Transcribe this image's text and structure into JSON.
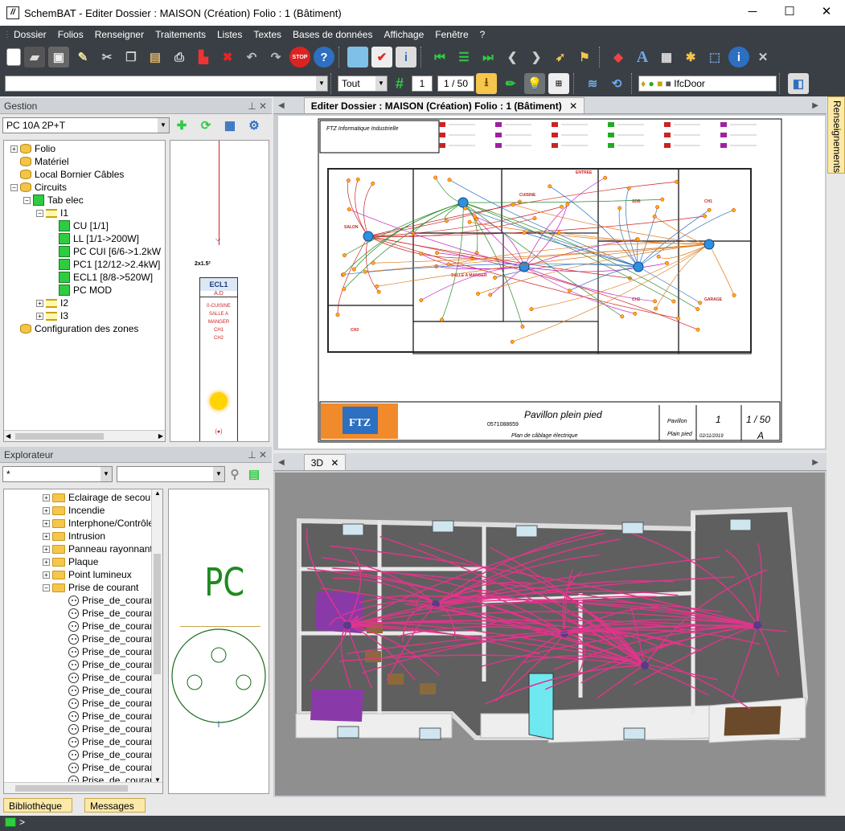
{
  "window": {
    "title": "SchemBAT - Editer  Dossier : MAISON  (Création)  Folio : 1  (Bâtiment)",
    "minimize": "─",
    "maximize": "☐",
    "close": "✕"
  },
  "menu": [
    "Dossier",
    "Folios",
    "Renseigner",
    "Traitements",
    "Listes",
    "Textes",
    "Bases de données",
    "Affichage",
    "Fenêtre",
    "?"
  ],
  "toolbar2": {
    "filter_value": "Tout",
    "page_input": "1",
    "page_count": "1 / 50",
    "layer_value": "IfcDoor"
  },
  "gestion": {
    "title": "Gestion",
    "pin": "⊥ ✕",
    "selected": "PC 10A 2P+T",
    "tree": [
      {
        "label": "Folio",
        "icon": "db",
        "indent": 0,
        "exp": "+"
      },
      {
        "label": "Matériel",
        "icon": "db",
        "indent": 0,
        "exp": ""
      },
      {
        "label": "Local Bornier Câbles",
        "icon": "db",
        "indent": 0,
        "exp": ""
      },
      {
        "label": "Circuits",
        "icon": "db",
        "indent": 0,
        "exp": "−"
      },
      {
        "label": "Tab elec",
        "icon": "green",
        "indent": 1,
        "exp": "−"
      },
      {
        "label": "I1",
        "icon": "rung",
        "indent": 2,
        "exp": "−"
      },
      {
        "label": "CU [1/1]",
        "icon": "green",
        "indent": 3,
        "exp": ""
      },
      {
        "label": "LL [1/1->200W]",
        "icon": "green",
        "indent": 3,
        "exp": ""
      },
      {
        "label": "PC CUI [6/6->1.2kW",
        "icon": "green",
        "indent": 3,
        "exp": ""
      },
      {
        "label": "PC1 [12/12->2.4kW]",
        "icon": "green",
        "indent": 3,
        "exp": ""
      },
      {
        "label": "ECL1 [8/8->520W]",
        "icon": "green",
        "indent": 3,
        "exp": ""
      },
      {
        "label": "PC MOD",
        "icon": "green",
        "indent": 3,
        "exp": ""
      },
      {
        "label": "I2",
        "icon": "rung",
        "indent": 2,
        "exp": "+"
      },
      {
        "label": "I3",
        "icon": "rung",
        "indent": 2,
        "exp": "+"
      },
      {
        "label": "Configuration des zones",
        "icon": "db",
        "indent": 0,
        "exp": ""
      }
    ],
    "circuit_preview": {
      "label": "ECL1",
      "sub": "A.D",
      "lines": [
        "0-CUISINE",
        "SALLE A MANGER",
        "CH1",
        "CH2"
      ],
      "cable": "2x1.5²",
      "marker": "(●)"
    }
  },
  "explorer": {
    "title": "Explorateur",
    "pin": "⊥ ✕",
    "combo1": "*",
    "combo2": "",
    "tree": [
      "Eclairage de secours",
      "Incendie",
      "Interphone/Contrôle",
      "Intrusion",
      "Panneau rayonnant v",
      "Plaque",
      "Point lumineux",
      "Prise de courant"
    ],
    "items": [
      "Prise_de_couran",
      "Prise_de_couran",
      "Prise_de_couran",
      "Prise_de_couran",
      "Prise_de_couran",
      "Prise_de_couran",
      "Prise_de_couran",
      "Prise_de_couran",
      "Prise_de_couran",
      "Prise_de_couran",
      "Prise_de_couran",
      "Prise_de_couran",
      "Prise_de_couran",
      "Prise_de_couran",
      "Prise_de_couran"
    ],
    "symbol_label": "PC"
  },
  "doc_tab": {
    "label": "Editer  Dossier : MAISON  (Création)  Folio : 1  (Bâtiment)",
    "close": "✕"
  },
  "sheet": {
    "company": "FTZ Informatique Industrielle",
    "project": "Pavillon plein pied",
    "subtitle": "Plan de câblage électrique",
    "folio": "1",
    "scale": "1 / 50",
    "rev": "A",
    "date": "02/11/2019",
    "code": "0571088659",
    "type1": "Pavillon",
    "type2": "Plain pied",
    "rooms": [
      "SALON",
      "CUISINE",
      "SALLE A MANGER",
      "ENTREE",
      "SDB",
      "CH1",
      "CH2",
      "GARAGE",
      "CH3"
    ]
  },
  "view3d_tab": {
    "label": "3D",
    "close": "✕"
  },
  "side_tab": "Renseignements",
  "bottom_tabs": [
    "Bibliothèque",
    "Messages"
  ],
  "status": ">",
  "colors": {
    "chrome": "#3a3f45",
    "accent": "#f5c64b",
    "wire_pink": "#e0358a",
    "wire_red": "#d42020"
  }
}
